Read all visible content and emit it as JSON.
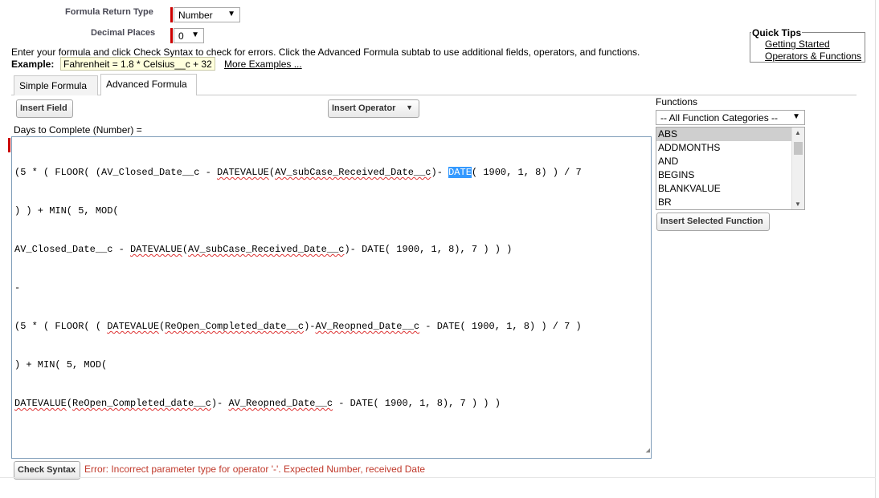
{
  "form": {
    "return_type_label": "Formula Return Type",
    "return_type_value": "Number",
    "decimal_places_label": "Decimal Places",
    "decimal_places_value": "0",
    "help_text": "Enter your formula and click Check Syntax to check for errors. Click the Advanced Formula subtab to use additional fields, operators, and functions.",
    "example_label": "Example:",
    "example_value": "Fahrenheit = 1.8 * Celsius__c + 32",
    "more_examples": "More Examples ..."
  },
  "quick_tips": {
    "title": "Quick Tips",
    "links": [
      "Getting Started",
      "Operators & Functions"
    ]
  },
  "tabs": [
    {
      "label": "Simple Formula",
      "active": false
    },
    {
      "label": "Advanced Formula",
      "active": true
    }
  ],
  "toolbar": {
    "insert_field": "Insert Field",
    "insert_operator": "Insert Operator",
    "check_syntax": "Check Syntax",
    "insert_selected_function": "Insert Selected Function"
  },
  "editor": {
    "label": "Days to Complete (Number) =",
    "lines": [
      "(5 * ( FLOOR( (AV_Closed_Date__c - DATEVALUE(AV_subCase_Received_Date__c)- DATE( 1900, 1, 8) ) / 7",
      ") ) + MIN( 5, MOD(",
      "AV_Closed_Date__c - DATEVALUE(AV_subCase_Received_Date__c)- DATE( 1900, 1, 8), 7 ) ) )",
      "-",
      "(5 * ( FLOOR( ( DATEVALUE(ReOpen_Completed_date__c)-AV_Reopned_Date__c - DATE( 1900, 1, 8) ) / 7 )",
      ") + MIN( 5, MOD(",
      "DATEVALUE(ReOpen_Completed_date__c)- AV_Reopned_Date__c - DATE( 1900, 1, 8), 7 ) ) )"
    ],
    "selected_token": "DATE"
  },
  "functions": {
    "label": "Functions",
    "category": "-- All Function Categories --",
    "items": [
      "ABS",
      "ADDMONTHS",
      "AND",
      "BEGINS",
      "BLANKVALUE",
      "BR"
    ],
    "selected": "ABS"
  },
  "error": "Error: Incorrect parameter type for operator '-'. Expected Number, received Date",
  "colors": {
    "required_bar": "#cc0000",
    "selection_highlight": "#3399ff",
    "error_text": "#c0392b",
    "example_bg": "#ffffdd"
  }
}
